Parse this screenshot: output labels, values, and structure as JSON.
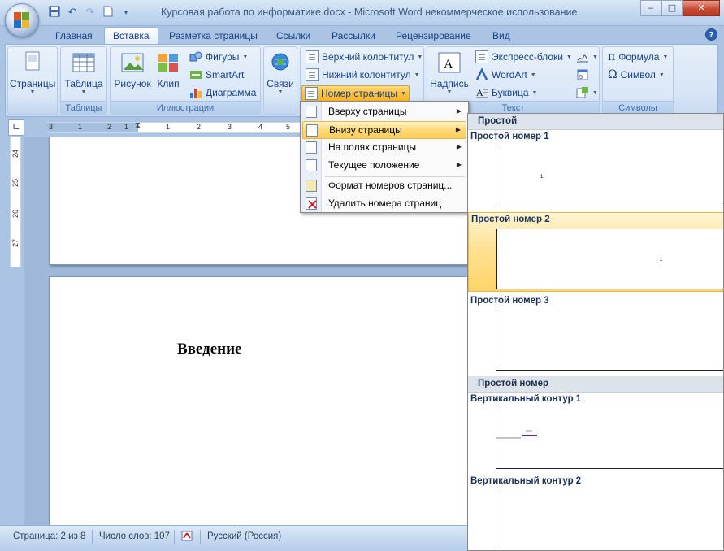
{
  "window": {
    "title": "Курсовая работа по информатике.docx - Microsoft Word некоммерческое использование",
    "minimize": "‒",
    "maximize": "□",
    "close": "✕"
  },
  "quick_access": {
    "save_icon": "save-icon",
    "undo_icon": "undo-icon",
    "redo_icon": "redo-icon",
    "new_icon": "new-document-icon",
    "customize_icon": "customize-icon"
  },
  "tabs": [
    "Главная",
    "Вставка",
    "Разметка страницы",
    "Ссылки",
    "Рассылки",
    "Рецензирование",
    "Вид"
  ],
  "active_tab": "Вставка",
  "help": "?",
  "ribbon": {
    "pages_group": {
      "button": "Страницы",
      "label": ""
    },
    "tables_group": {
      "button": "Таблица",
      "label": "Таблицы"
    },
    "illustrations_group": {
      "picture": "Рисунок",
      "clip": "Клип",
      "shapes": "Фигуры",
      "smartart": "SmartArt",
      "chart": "Диаграмма",
      "label": "Иллюстрации"
    },
    "links_group": {
      "button": "Связи",
      "label": ""
    },
    "header_footer_group": {
      "header": "Верхний колонтитул",
      "footer": "Нижний колонтитул",
      "page_number": "Номер страницы"
    },
    "text_group": {
      "textbox": "Надпись",
      "quickparts": "Экспресс-блоки",
      "wordart": "WordArt",
      "dropcap": "Буквица",
      "label": "Текст"
    },
    "symbols_group": {
      "equation": "Формула",
      "symbol": "Символ",
      "label": "Символы"
    }
  },
  "menu": {
    "items": [
      {
        "label": "Вверху страницы",
        "has_submenu": true
      },
      {
        "label": "Внизу страницы",
        "has_submenu": true,
        "highlighted": true
      },
      {
        "label": "На полях страницы",
        "has_submenu": true
      },
      {
        "label": "Текущее положение",
        "has_submenu": true
      },
      {
        "label": "Формат номеров страниц...",
        "has_submenu": false
      },
      {
        "label": "Удалить номера страниц",
        "has_submenu": false
      }
    ]
  },
  "gallery": {
    "section1": "Простой",
    "items1": [
      {
        "title": "Простой номер 1",
        "num": "1"
      },
      {
        "title": "Простой номер 2",
        "num": "1",
        "highlighted": true
      },
      {
        "title": "Простой номер 3",
        "num": ""
      }
    ],
    "section2": "Простой номер",
    "items2": [
      {
        "title": "Вертикальный контур 1"
      },
      {
        "title": "Вертикальный контур 2"
      }
    ]
  },
  "ruler": {
    "h_ticks": [
      "3",
      "1",
      "2",
      "1",
      "1",
      "2",
      "3",
      "4",
      "5"
    ],
    "v_ticks": [
      "24",
      "25",
      "26",
      "27"
    ]
  },
  "document": {
    "heading": "Введение"
  },
  "statusbar": {
    "page": "Страница: 2 из 8",
    "words": "Число слов: 107",
    "language": "Русский (Россия)"
  }
}
